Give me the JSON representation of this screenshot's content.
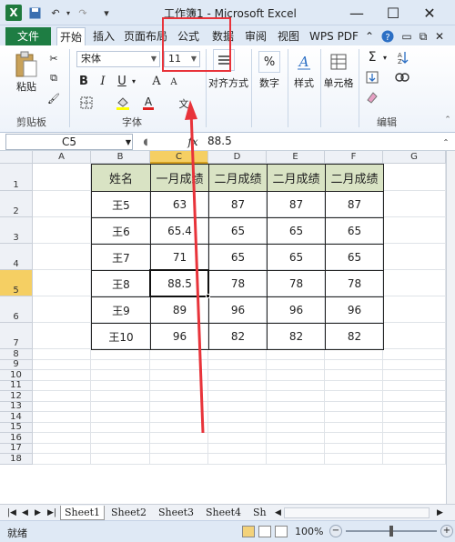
{
  "window": {
    "title": "工作簿1 - Microsoft Excel",
    "app_icon": "X",
    "min": "—",
    "max": "☐",
    "close": "✕"
  },
  "tabs": [
    "文件",
    "开始",
    "插入",
    "页面布局",
    "公式",
    "数据",
    "审阅",
    "视图",
    "WPS PDF"
  ],
  "ribbon": {
    "paste": "粘贴",
    "clipboard": "剪贴板",
    "font_name": "宋体",
    "font_size": "11",
    "font_group": "字体",
    "bold": "B",
    "italic": "I",
    "underline": "U",
    "grow": "A",
    "shrink": "A",
    "align": "对齐方式",
    "number": "数字",
    "percent": "%",
    "style": "样式",
    "cells": "单元格",
    "edit": "编辑",
    "sigma": "Σ"
  },
  "formula_bar": {
    "cell_ref": "C5",
    "fx": "fx",
    "value": "88.5"
  },
  "columns": [
    "A",
    "B",
    "C",
    "D",
    "E",
    "F",
    "G"
  ],
  "rows": [
    "1",
    "2",
    "3",
    "4",
    "5",
    "6",
    "7",
    "8",
    "9",
    "10",
    "11",
    "12",
    "13",
    "14",
    "15",
    "16",
    "17",
    "18"
  ],
  "table": {
    "headers": [
      "姓名",
      "一月成绩",
      "二月成绩",
      "二月成绩",
      "二月成绩"
    ],
    "rows": [
      [
        "王5",
        "63",
        "87",
        "87",
        "87"
      ],
      [
        "王6",
        "65.4",
        "65",
        "65",
        "65"
      ],
      [
        "王7",
        "71",
        "65",
        "65",
        "65"
      ],
      [
        "王8",
        "88.5",
        "78",
        "78",
        "78"
      ],
      [
        "王9",
        "89",
        "96",
        "96",
        "96"
      ],
      [
        "王10",
        "96",
        "82",
        "82",
        "82"
      ]
    ]
  },
  "sheets": [
    "Sheet1",
    "Sheet2",
    "Sheet3",
    "Sheet4",
    "Sh"
  ],
  "status": {
    "ready": "就绪",
    "zoom": "100%"
  },
  "colors": {
    "accent": "#1e7d43",
    "header_fill": "#d9e3c4",
    "annotation": "#e8333a"
  }
}
